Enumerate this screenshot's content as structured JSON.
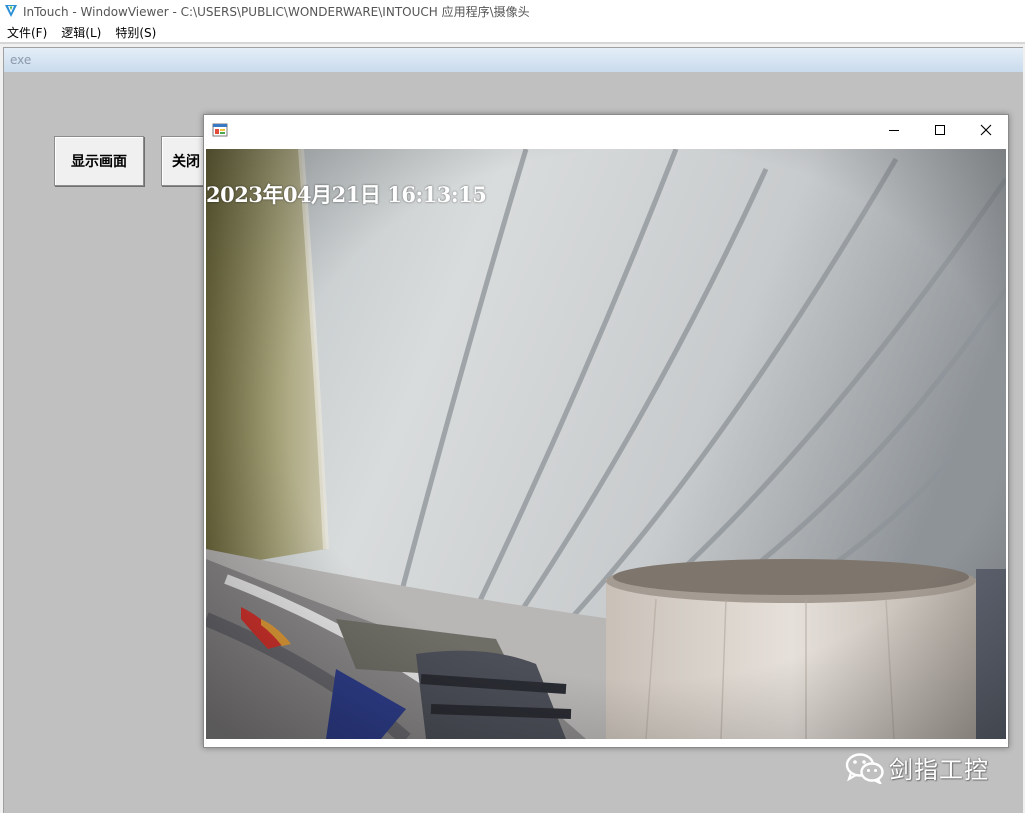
{
  "app": {
    "title": "InTouch - WindowViewer - C:\\USERS\\PUBLIC\\WONDERWARE\\INTOUCH 应用程序\\摄像头",
    "logo_icon": "intouch-logo-icon"
  },
  "menu": {
    "items": [
      {
        "label": "文件(F)"
      },
      {
        "label": "逻辑(L)"
      },
      {
        "label": "特别(S)"
      }
    ]
  },
  "child_window": {
    "title": "exe"
  },
  "buttons": {
    "show_label": "显示画面",
    "close_label": "关闭"
  },
  "popup": {
    "icon": "app-window-icon",
    "timestamp": "2023年04月21日 16:13:15"
  },
  "watermark": {
    "icon": "wechat-icon",
    "text": "剑指工控"
  },
  "colors": {
    "child_background": "#c0c0c0",
    "child_title_gradient_top": "#e4eef8",
    "child_title_gradient_bottom": "#c9dbed"
  }
}
